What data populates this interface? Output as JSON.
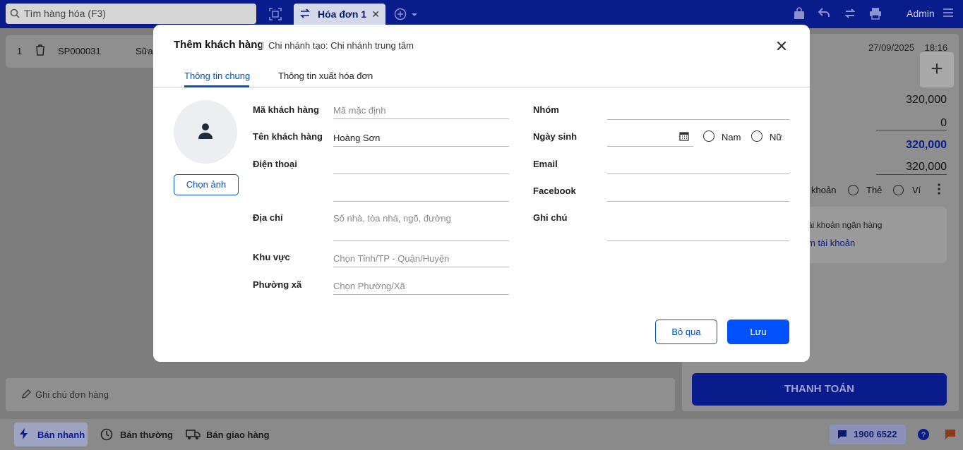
{
  "topbar": {
    "search_placeholder": "Tìm hàng hóa (F3)",
    "tab_label": "Hóa đơn 1",
    "tab_close": "✕",
    "admin": "Admin"
  },
  "cart": {
    "row_index": "1",
    "row_code": "SP000031",
    "row_name": "Sữa"
  },
  "summary": {
    "date": "27/09/2025",
    "time": "18:16",
    "total": "320,000",
    "discount": "0",
    "to_pay": "320,000",
    "paid": "320,000",
    "pay_methods": [
      "khoản",
      "Thẻ",
      "Ví"
    ],
    "bank_text": "ài khoản ngân hàng",
    "bank_link": "m tài khoản",
    "pay_button": "THANH TOÁN"
  },
  "note_placeholder": "Ghi chú đơn hàng",
  "bottombar": {
    "items": [
      "Bán nhanh",
      "Bán thường",
      "Bán giao hàng"
    ],
    "hotline": "1900 6522"
  },
  "modal": {
    "title": "Thêm khách hàng",
    "subtitle": "Chi nhánh tạo: Chi nhánh trung tâm",
    "tabs": [
      "Thông tin chung",
      "Thông tin xuất hóa đơn"
    ],
    "choose_image": "Chọn ảnh",
    "left_fields": {
      "code_label": "Mã khách hàng",
      "code_placeholder": "Mã mặc định",
      "name_label": "Tên khách hàng",
      "name_value": "Hoàng Sơn",
      "phone_label": "Điện thoại",
      "address_label": "Địa chỉ",
      "address_placeholder": "Số nhà, tòa nhà, ngõ, đường",
      "area_label": "Khu vực",
      "area_placeholder": "Chọn Tỉnh/TP - Quận/Huyện",
      "ward_label": "Phường xã",
      "ward_placeholder": "Chọn Phường/Xã"
    },
    "right_fields": {
      "group_label": "Nhóm",
      "birthday_label": "Ngày sinh",
      "gender_male": "Nam",
      "gender_female": "Nữ",
      "email_label": "Email",
      "facebook_label": "Facebook",
      "note_label": "Ghi chú"
    },
    "buttons": {
      "skip": "Bỏ qua",
      "save": "Lưu"
    }
  }
}
